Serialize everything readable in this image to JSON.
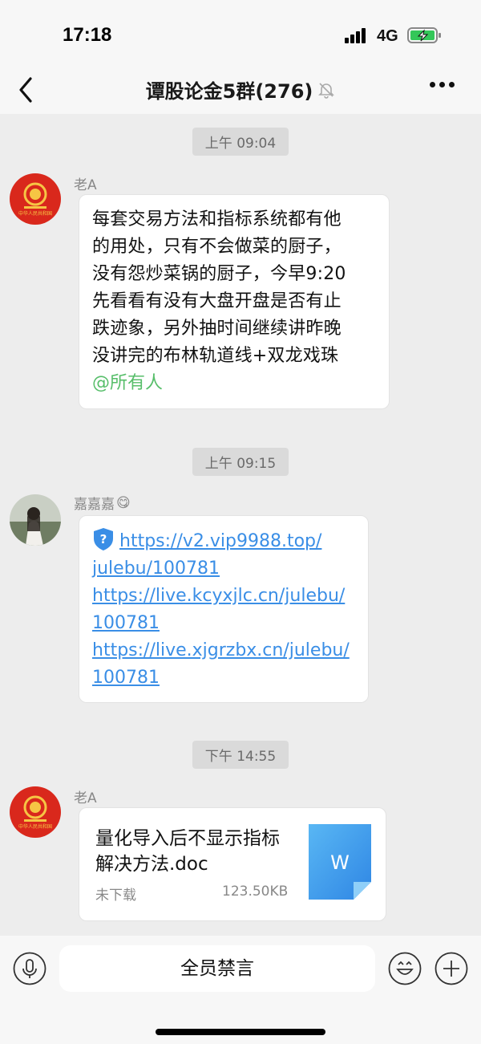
{
  "status_bar": {
    "time": "17:18",
    "network": "4G"
  },
  "nav": {
    "title": "谭股论金5群(276)"
  },
  "messages": [
    {
      "timestamp": "上午 09:04",
      "sender": "老A",
      "text": "每套交易方法和指标系统都有他\n的用处，只有不会做菜的厨子，\n没有怨炒菜锅的厨子，今早9:20\n先看看有没有大盘开盘是否有止\n跌迹象，另外抽时间继续讲昨晚\n没讲完的布林轨道线+双龙戏珠",
      "mention": "@所有人"
    },
    {
      "timestamp": "上午 09:15",
      "sender": "嘉嘉嘉",
      "sender_emoji": "😋",
      "links": [
        "https://v2.vip9988.top/",
        "julebu/100781",
        "https://live.kcyxjlc.cn/julebu/",
        "100781",
        "https://live.xjgrzbx.cn/julebu/",
        "100781"
      ]
    },
    {
      "timestamp": "下午 14:55",
      "sender": "老A",
      "file": {
        "name": "量化导入后不显示指标解决方法.doc",
        "status": "未下载",
        "size": "123.50KB",
        "icon_letter": "W"
      }
    }
  ],
  "avatar_badge_text": "中华人民共和国",
  "input_bar": {
    "mute_label": "全员禁言"
  },
  "colors": {
    "mention": "#57be6a",
    "link": "#3a8ee6",
    "background": "#ededed"
  }
}
